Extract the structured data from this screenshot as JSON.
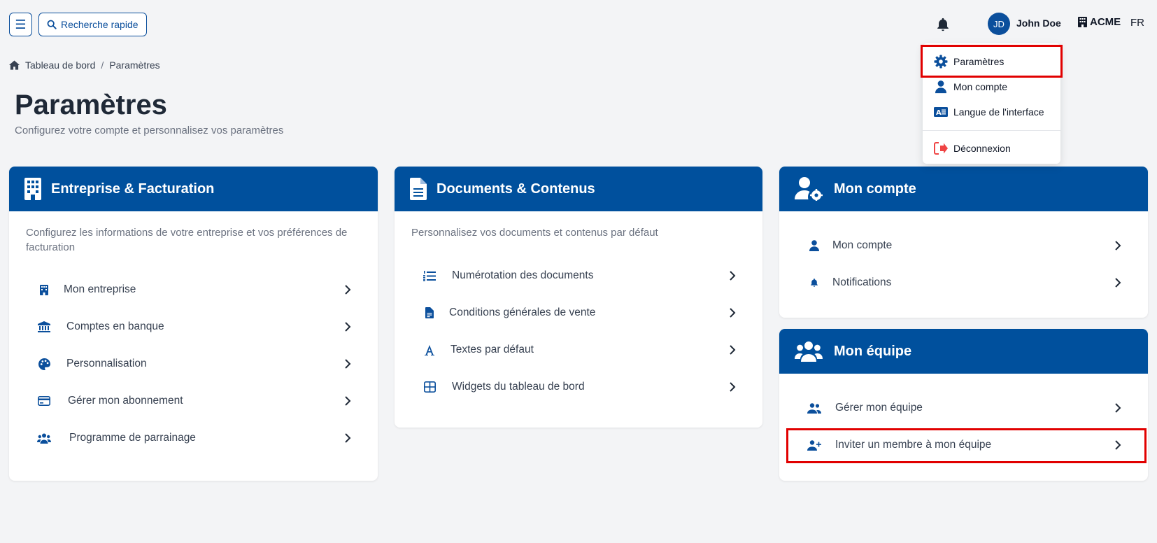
{
  "topbar": {
    "search_label": "Recherche rapide",
    "avatar_initials": "JD",
    "user_name": "John Doe",
    "company_name": "ACME",
    "language": "FR"
  },
  "breadcrumb": {
    "home": "Tableau de bord",
    "separator": "/",
    "current": "Paramètres"
  },
  "page": {
    "title": "Paramètres",
    "subtitle": "Configurez votre compte et personnalisez vos paramètres"
  },
  "user_menu": {
    "items": [
      {
        "label": "Paramètres",
        "icon": "gear-icon"
      },
      {
        "label": "Mon compte",
        "icon": "user-icon"
      },
      {
        "label": "Langue de l'interface",
        "icon": "language-icon"
      },
      {
        "label": "Déconnexion",
        "icon": "logout-icon"
      }
    ]
  },
  "cards": {
    "billing": {
      "title": "Entreprise & Facturation",
      "description": "Configurez les informations de votre entreprise et vos préférences de facturation",
      "items": [
        {
          "label": "Mon entreprise",
          "icon": "building-icon"
        },
        {
          "label": "Comptes en banque",
          "icon": "bank-icon"
        },
        {
          "label": "Personnalisation",
          "icon": "palette-icon"
        },
        {
          "label": "Gérer mon abonnement",
          "icon": "credit-card-icon"
        },
        {
          "label": "Programme de parrainage",
          "icon": "users-icon"
        }
      ]
    },
    "documents": {
      "title": "Documents & Contenus",
      "description": "Personnalisez vos documents et contenus par défaut",
      "items": [
        {
          "label": "Numérotation des documents",
          "icon": "numbered-list-icon"
        },
        {
          "label": "Conditions générales de vente",
          "icon": "document-icon"
        },
        {
          "label": "Textes par défaut",
          "icon": "font-icon"
        },
        {
          "label": "Widgets du tableau de bord",
          "icon": "grid-icon"
        }
      ]
    },
    "account": {
      "title": "Mon compte",
      "items": [
        {
          "label": "Mon compte",
          "icon": "user-icon"
        },
        {
          "label": "Notifications",
          "icon": "bell-icon"
        }
      ]
    },
    "team": {
      "title": "Mon équipe",
      "items": [
        {
          "label": "Gérer mon équipe",
          "icon": "users-icon"
        },
        {
          "label": "Inviter un membre à mon équipe",
          "icon": "user-plus-icon"
        }
      ]
    }
  },
  "colors": {
    "primary": "#00509d",
    "highlight": "#e10000",
    "logout": "#ef4444",
    "background": "#f3f4f6"
  }
}
